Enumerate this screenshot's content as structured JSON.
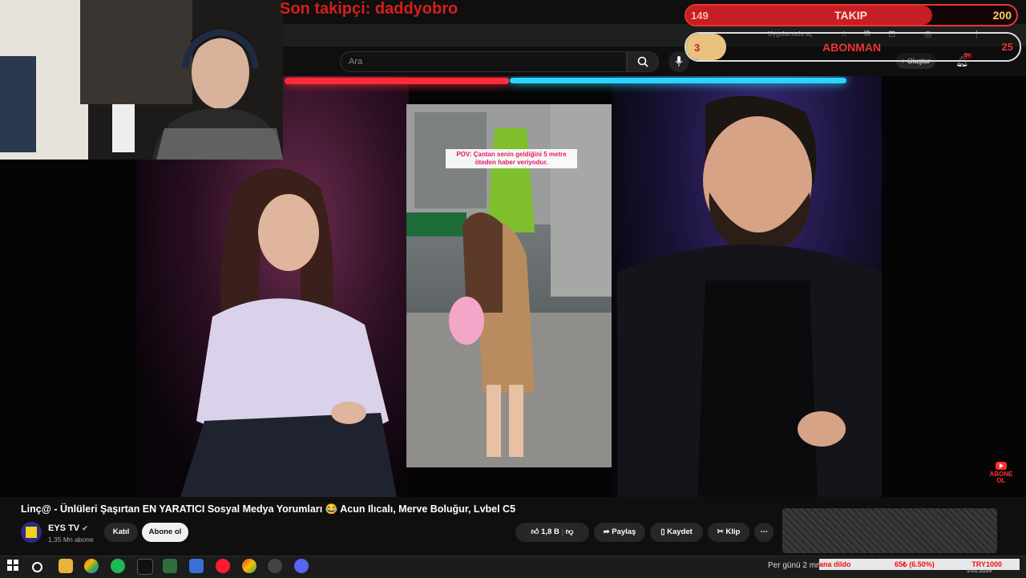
{
  "overlay": {
    "last_follower": "Son takipçi: daddyobro",
    "follow_goal": {
      "current": "149",
      "label": "TAKIP",
      "target": "200",
      "progress": 0.745
    },
    "sub_goal": {
      "current": "3",
      "label": "ABONMAN",
      "target": "25",
      "progress": 0.12
    }
  },
  "browser": {
    "open_in_app": "Uygulamada aç"
  },
  "youtube_header": {
    "search_placeholder": "Ara",
    "create_label": "Oluştur",
    "notif_badge": "9+"
  },
  "video": {
    "pov_caption": "POV: Çantan senin geldiğini 5 metre öteden haber veriyodur.",
    "abone_ol_badge": "ABONE OL",
    "title": "Linç@ - Ünlüleri Şaşırtan EN YARATICI Sosyal Medya Yorumları 😂 Acun Ilıcalı, Merve Boluğur, Lvbel C5",
    "channel_name": "EYS TV",
    "channel_subs": "1,35 Mn abone",
    "join_label": "Katıl",
    "subscribe_label": "Abone ol",
    "likes": "1,8 B",
    "share_label": "Paylaş",
    "save_label": "Kaydet",
    "clip_label": "Klip"
  },
  "taskbar": {
    "weather_text": "Per günü 2 mm",
    "ticker_text": "ana dildo",
    "ticker_value": "65₺ (6.50%)",
    "ticker_goal": "TRY1000",
    "date": "5.01.2026"
  },
  "colors": {
    "follow_red": "#c51f24",
    "sub_gold": "#e9c27d",
    "pov_pink": "#e2186e"
  }
}
